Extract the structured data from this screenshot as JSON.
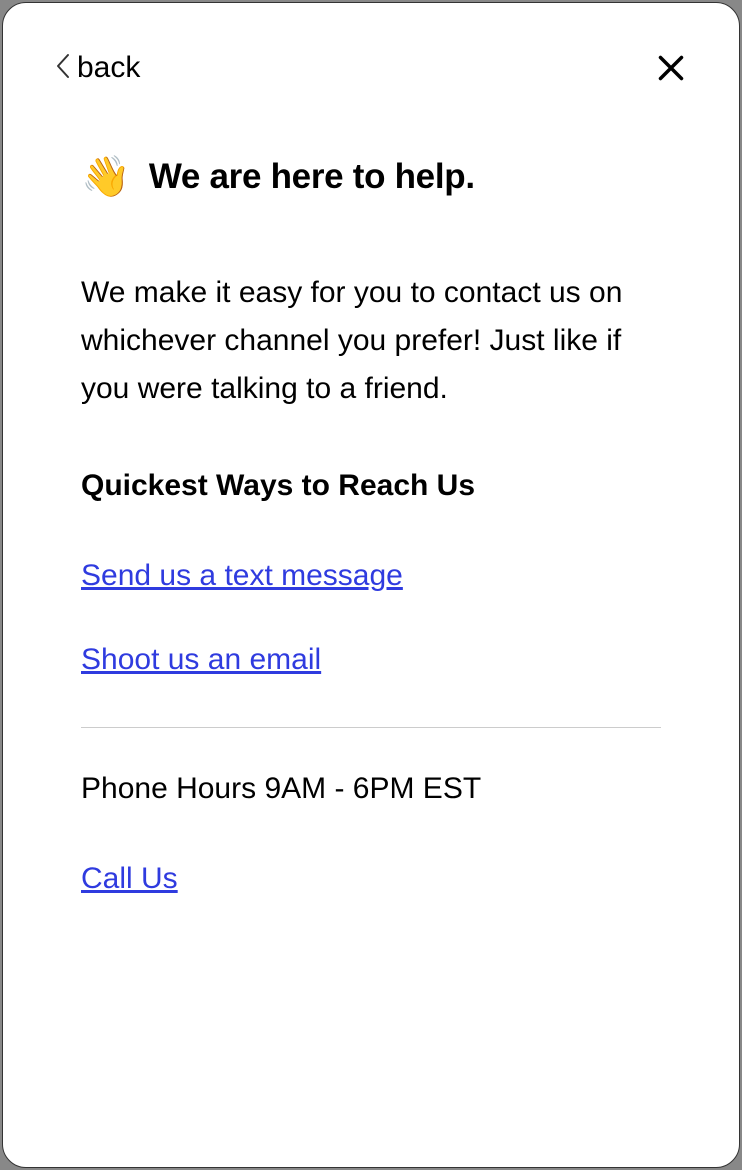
{
  "header": {
    "back_label": "back"
  },
  "content": {
    "wave_emoji": "👋",
    "title": "We are here to help.",
    "description": "We make it easy for you to contact us on whichever channel you prefer! Just like if you were talking to a friend.",
    "subheading": "Quickest Ways to Reach Us",
    "link_text": "Send us a text message",
    "link_email": "Shoot us an email",
    "phone_hours": "Phone Hours 9AM - 6PM EST",
    "link_call": "Call Us"
  }
}
